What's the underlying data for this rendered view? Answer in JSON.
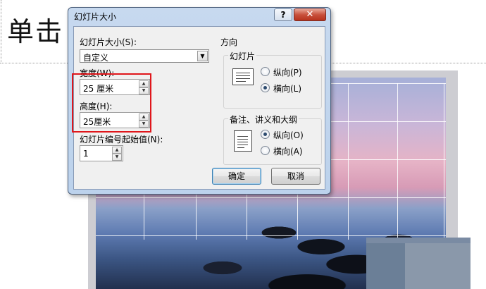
{
  "background": {
    "title_text": "单击"
  },
  "dialog": {
    "title": "幻灯片大小",
    "help_label": "?",
    "close_label": "✕",
    "slide_size_label": "幻灯片大小(S):",
    "slide_size_value": "自定义",
    "width_label": "宽度(W):",
    "width_value": "25 厘米",
    "height_label": "高度(H):",
    "height_value": "25厘米",
    "start_number_label": "幻灯片编号起始值(N):",
    "start_number_value": "1",
    "orientation_label": "方向",
    "slides_group_label": "幻灯片",
    "slides_portrait": "纵向(P)",
    "slides_landscape": "横向(L)",
    "slides_selected": "landscape",
    "notes_group_label": "备注、讲义和大纲",
    "notes_portrait": "纵向(O)",
    "notes_landscape": "横向(A)",
    "notes_selected": "portrait",
    "ok_label": "确定",
    "cancel_label": "取消"
  },
  "colors": {
    "highlight": "#e0161b",
    "dialog_frame": "#c7d9ef"
  },
  "icons": [
    "landscape-page-icon",
    "portrait-page-icon",
    "dropdown-arrow-icon",
    "spin-up-icon",
    "spin-down-icon"
  ]
}
